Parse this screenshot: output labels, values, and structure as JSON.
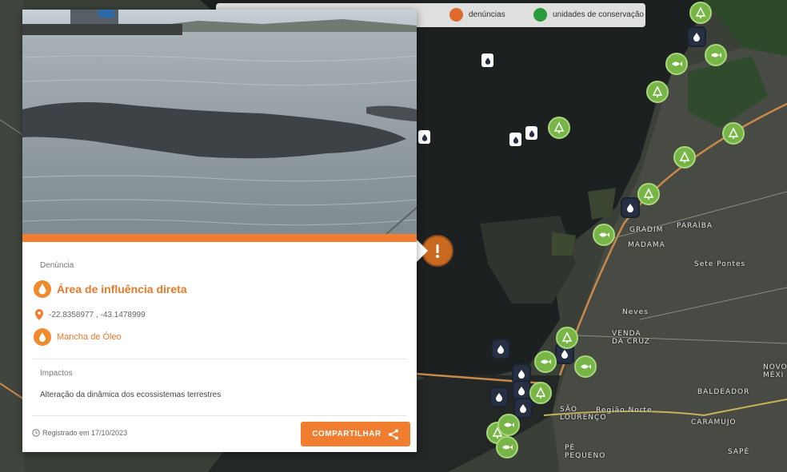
{
  "legend": {
    "items": [
      {
        "label": "denúncias",
        "color": "#e06a2c"
      },
      {
        "label": "unidades de conservação",
        "color": "#2a9b3a"
      }
    ]
  },
  "map": {
    "labels": {
      "gradim": "GRADIM",
      "madama": "MADAMA",
      "sete_pontes": "Sete Pontes",
      "neves": "Neves",
      "venda_da_cruz": "VENDA\nDA CRUZ",
      "baldeador": "BALDEADOR",
      "regiao_norte": "Região Norte",
      "caramujo": "CARAMUJO",
      "sao_lourenco": "SÃO\nLOURENÇO",
      "pe_pequeno": "PÉ\nPEQUENO",
      "sape": "SAPÉ",
      "novo_mexico": "NOVO\nMÉXI",
      "paraiba": "PARAÍBA"
    }
  },
  "card": {
    "category_label": "Denúncia",
    "title": "Área de influência direta",
    "coordinates": "-22.8358977 , -43.1478999",
    "type": "Mancha de Óleo",
    "impacts_label": "Impactos",
    "impacts_text": "Alteração da dinâmica dos ecossistemas terrestres",
    "registered": "Registrado em 17/10/2023",
    "share_label": "COMPARTILHAR"
  },
  "colors": {
    "accent": "#f07d30",
    "marker_dark": "#263042",
    "marker_green": "#76b546"
  }
}
